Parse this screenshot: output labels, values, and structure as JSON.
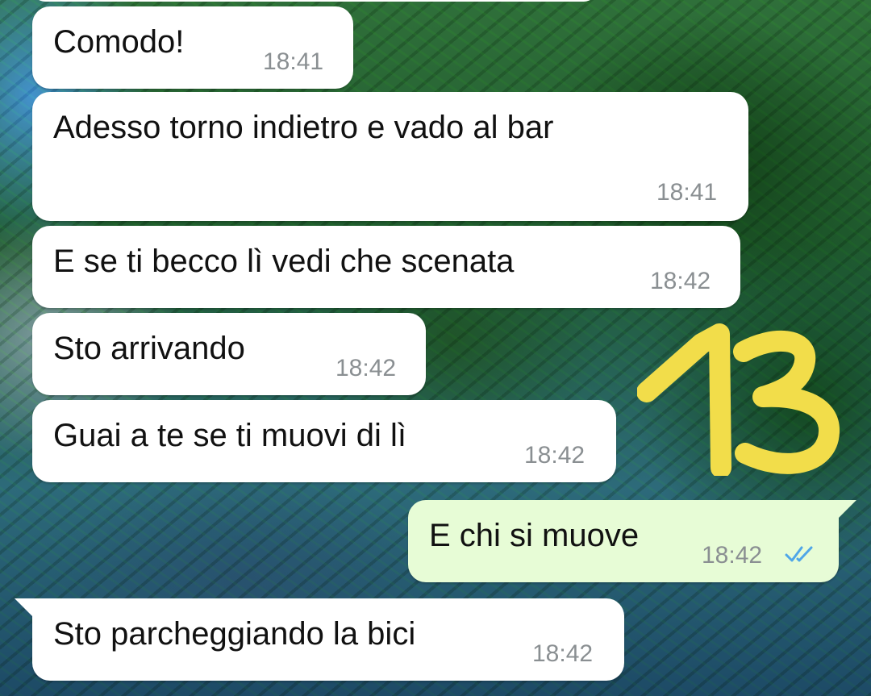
{
  "chat": {
    "messages": [
      {
        "text": "Comodo!",
        "time": "18:41",
        "direction": "incoming"
      },
      {
        "text": "Adesso torno indietro e vado al bar",
        "time": "18:41",
        "direction": "incoming"
      },
      {
        "text": "E se ti becco lì vedi che scenata",
        "time": "18:42",
        "direction": "incoming"
      },
      {
        "text": "Sto arrivando",
        "time": "18:42",
        "direction": "incoming"
      },
      {
        "text": "Guai a te se ti muovi di lì",
        "time": "18:42",
        "direction": "incoming"
      },
      {
        "text": "E chi si muove",
        "time": "18:42",
        "direction": "outgoing",
        "status": "read"
      },
      {
        "text": "Sto parcheggiando la bici",
        "time": "18:42",
        "direction": "incoming"
      }
    ]
  },
  "overlay": {
    "number": "13",
    "color": "#f2dd4a"
  },
  "colors": {
    "incoming_bubble": "#ffffff",
    "outgoing_bubble": "#e7fcd6",
    "timestamp": "#8a8f92",
    "read_ticks": "#4fa6e8"
  },
  "icons": {
    "read_receipt": "double-check-icon"
  }
}
